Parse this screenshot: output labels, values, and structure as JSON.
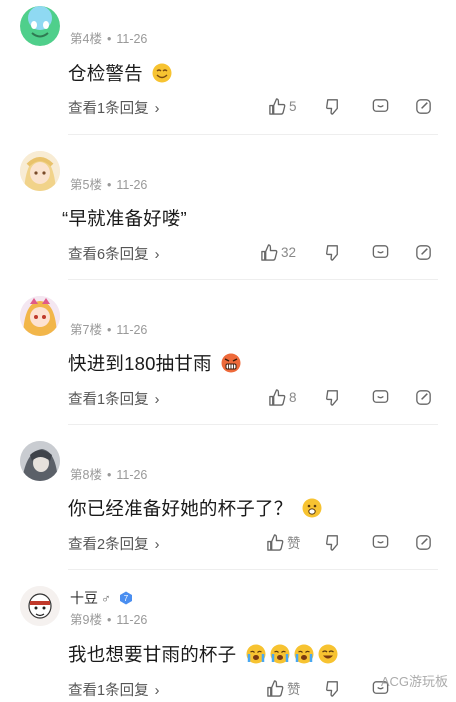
{
  "comments": [
    {
      "floor": "第4楼",
      "date": "11-26",
      "text": "仓检警告",
      "emoji": "smile-emoji",
      "replies": "查看1条回复",
      "likes": "5",
      "avatar": "green-ball-avatar"
    },
    {
      "floor": "第5楼",
      "date": "11-26",
      "text": "“早就准备好喽”",
      "replies": "查看6条回复",
      "likes": "32",
      "avatar": "blonde-anime-girl-avatar"
    },
    {
      "floor": "第7楼",
      "date": "11-26",
      "text": "快进到180抽甘雨",
      "emoji": "angry-emoji",
      "replies": "查看1条回复",
      "likes": "8",
      "avatar": "anime-girl-avatar"
    },
    {
      "floor": "第8楼",
      "date": "11-26",
      "text": "你已经准备好她的杯子了？",
      "emoji": "worried-emoji",
      "replies": "查看2条回复",
      "likes": "赞",
      "avatar": "grey-character-avatar"
    },
    {
      "username": "十豆",
      "gender": "♂",
      "level": "7",
      "floor": "第9楼",
      "date": "11-26",
      "text": "我也想要甘雨的杯子",
      "emojis": [
        "crying-emoji",
        "crying-emoji",
        "crying-emoji",
        "laughing-emoji"
      ],
      "replies": "查看1条回复",
      "likes": "赞",
      "avatar": "cartoon-character-avatar"
    }
  ],
  "watermark": "ACG游玩板",
  "colors": {
    "meta": "#999999",
    "text": "#1a1a1a",
    "icon": "#666666",
    "emoji": "#f7c331",
    "level_badge": "#4a8ef0"
  }
}
